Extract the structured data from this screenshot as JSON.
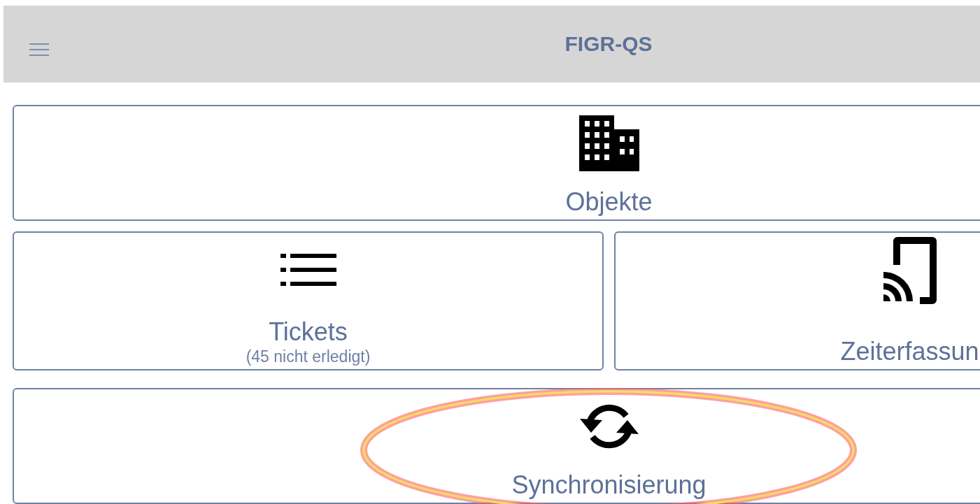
{
  "header": {
    "title": "FIGR-QS"
  },
  "tiles": [
    {
      "kind": "building",
      "label": "Objekte",
      "full_width": true
    },
    {
      "kind": "list",
      "label": "Tickets",
      "sublabel": "(45 nicht erledigt)",
      "full_width": false
    },
    {
      "kind": "cast",
      "label": "Zeiterfassun",
      "full_width": false
    },
    {
      "kind": "sync",
      "label": "Synchronisierung",
      "full_width": true,
      "highlighted": true
    }
  ]
}
